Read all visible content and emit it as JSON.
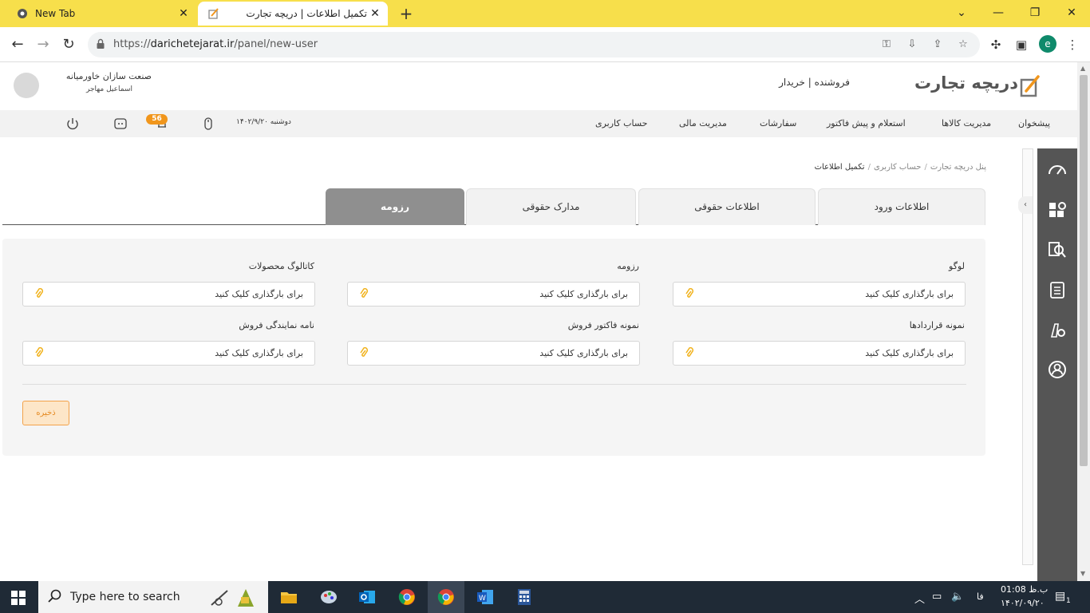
{
  "browser": {
    "tabs": [
      {
        "title": "New Tab"
      },
      {
        "title": "تکمیل اطلاعات | دریچه تجارت"
      }
    ],
    "url_prefix": "https://",
    "url_host": "darichetejarat.ir",
    "url_path": "/panel/new-user",
    "profile_initial": "e"
  },
  "header": {
    "company": "صنعت سازان خاورمیانه",
    "user": "اسماعیل مهاجر",
    "roles": "فروشنده | خریدار",
    "logo_text": "دریچه تجارت"
  },
  "menu": {
    "items": [
      "پیشخوان",
      "مدیریت کالاها",
      "استعلام و پیش فاکتور",
      "سفارشات",
      "مدیریت مالی",
      "حساب کاربری"
    ],
    "date": "دوشنبه ۱۴۰۲/۹/۲۰",
    "notification_count": "56"
  },
  "breadcrumb": {
    "root": "پنل دریچه تجارت",
    "parent": "حساب کاربری",
    "current": "تکمیل اطلاعات"
  },
  "tabs": [
    "اطلاعات ورود",
    "اطلاعات حقوقی",
    "مدارک حقوقی",
    "رزومه"
  ],
  "active_tab": "رزومه",
  "form": {
    "fields": [
      {
        "label": "لوگو",
        "placeholder": "برای بارگذاری کلیک کنید"
      },
      {
        "label": "رزومه",
        "placeholder": "برای بارگذاری کلیک کنید"
      },
      {
        "label": "کاتالوگ محصولات",
        "placeholder": "برای بارگذاری کلیک کنید"
      },
      {
        "label": "نمونه قراردادها",
        "placeholder": "برای بارگذاری کلیک کنید"
      },
      {
        "label": "نمونه فاکتور فروش",
        "placeholder": "برای بارگذاری کلیک کنید"
      },
      {
        "label": "نامه نمایندگی فروش",
        "placeholder": "برای بارگذاری کلیک کنید"
      }
    ],
    "save_label": "ذخیره"
  },
  "taskbar": {
    "search_placeholder": "Type here to search",
    "lang": "فا",
    "time": "01:08 ب.ظ",
    "date": "۱۴۰۲/۰۹/۲۰",
    "notif_count": "1"
  },
  "colors": {
    "tabstrip": "#f7df4b",
    "accent_orange": "#f1961c",
    "active_tab": "#8f8f8f",
    "side_column": "#555555"
  }
}
